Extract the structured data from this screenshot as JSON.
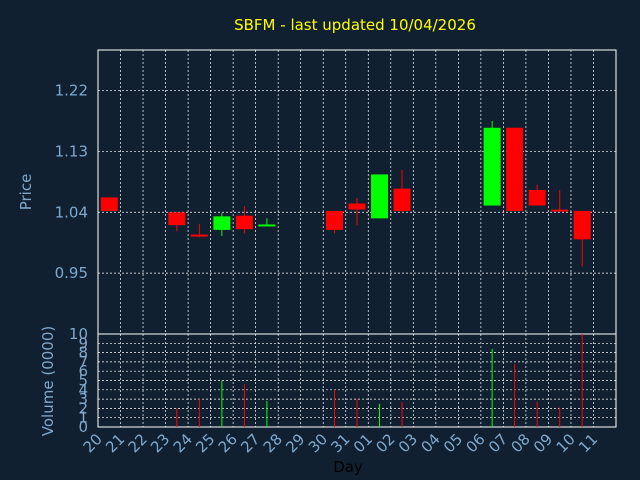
{
  "chart_data": {
    "type": "candlestick",
    "title": "SBFM - last updated 10/04/2026",
    "xlabel": "Day",
    "price_panel": {
      "ylabel": "Price",
      "ylim": [
        0.86,
        1.28
      ],
      "yticks": [
        "1.22",
        "1.13",
        "1.04",
        "0.95"
      ],
      "ytick_values": [
        1.22,
        1.13,
        1.04,
        0.95
      ]
    },
    "volume_panel": {
      "ylabel": "Volume (0000)",
      "ylim": [
        0,
        10
      ],
      "yticks": [
        "10",
        "9",
        "8",
        "7",
        "6",
        "5",
        "4",
        "3",
        "2",
        "1",
        "0"
      ],
      "ytick_values": [
        10,
        9,
        8,
        7,
        6,
        5,
        4,
        3,
        2,
        1,
        0
      ]
    },
    "x_ticks": [
      "20",
      "21",
      "22",
      "23",
      "24",
      "25",
      "26",
      "27",
      "28",
      "29",
      "30",
      "31",
      "01",
      "02",
      "03",
      "04",
      "05",
      "06",
      "07",
      "08",
      "09",
      "10",
      "11"
    ],
    "grid": true,
    "colors": {
      "background": "#102030",
      "up": "#00ff00",
      "down": "#ff0000",
      "grid": "#ffffff",
      "title": "#ffff00",
      "axis_text": "#7fa8cc"
    },
    "candles": [
      {
        "day": "20",
        "open": 1.062,
        "high": 1.062,
        "low": 1.042,
        "close": 1.042,
        "volume": 0.0
      },
      {
        "day": "23",
        "open": 1.04,
        "high": 1.04,
        "low": 1.012,
        "close": 1.021,
        "volume": 2.0
      },
      {
        "day": "24",
        "open": 1.007,
        "high": 1.023,
        "low": 1.003,
        "close": 1.005,
        "volume": 3.0
      },
      {
        "day": "25",
        "open": 1.014,
        "high": 1.039,
        "low": 1.005,
        "close": 1.034,
        "volume": 5.0
      },
      {
        "day": "26",
        "open": 1.035,
        "high": 1.049,
        "low": 1.009,
        "close": 1.015,
        "volume": 4.6
      },
      {
        "day": "27",
        "open": 1.02,
        "high": 1.031,
        "low": 1.019,
        "close": 1.022,
        "volume": 2.8
      },
      {
        "day": "30",
        "open": 1.042,
        "high": 1.042,
        "low": 1.009,
        "close": 1.014,
        "volume": 4.0
      },
      {
        "day": "31",
        "open": 1.053,
        "high": 1.061,
        "low": 1.021,
        "close": 1.044,
        "volume": 3.0
      },
      {
        "day": "01",
        "open": 1.031,
        "high": 1.096,
        "low": 1.031,
        "close": 1.096,
        "volume": 2.5
      },
      {
        "day": "02",
        "open": 1.075,
        "high": 1.103,
        "low": 1.04,
        "close": 1.042,
        "volume": 2.7
      },
      {
        "day": "06",
        "open": 1.05,
        "high": 1.175,
        "low": 1.05,
        "close": 1.165,
        "volume": 8.4
      },
      {
        "day": "07",
        "open": 1.165,
        "high": 1.165,
        "low": 1.042,
        "close": 1.042,
        "volume": 6.8
      },
      {
        "day": "08",
        "open": 1.073,
        "high": 1.081,
        "low": 1.05,
        "close": 1.05,
        "volume": 2.7
      },
      {
        "day": "09",
        "open": 1.044,
        "high": 1.073,
        "low": 1.041,
        "close": 1.042,
        "volume": 2.1
      },
      {
        "day": "10",
        "open": 1.042,
        "high": 1.042,
        "low": 0.96,
        "close": 1.0,
        "volume": 10.0
      }
    ]
  }
}
